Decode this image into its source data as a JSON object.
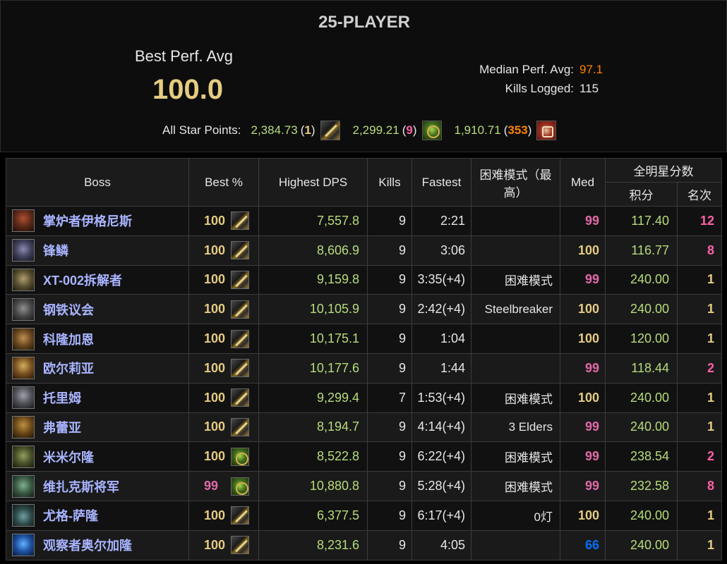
{
  "header": {
    "raid_size": "25-PLAYER",
    "best_perf_label": "Best Perf. Avg",
    "best_perf_value": "100.0",
    "median_label": "Median Perf. Avg:",
    "median_value": "97.1",
    "kills_label": "Kills Logged:",
    "kills_value": "115",
    "star_points_label": "All Star Points:",
    "star_points": [
      {
        "value": "2,384.73",
        "rank": "1",
        "rank_color": "#e5cc80",
        "icon": "rogue-combat-icon"
      },
      {
        "value": "2,299.21",
        "rank": "9",
        "rank_color": "#ff5fa8",
        "icon": "rogue-assassination-icon"
      },
      {
        "value": "1,910.71",
        "rank": "353",
        "rank_color": "#ff8000",
        "icon": "rogue-subtlety-icon"
      }
    ]
  },
  "table": {
    "headers": {
      "boss": "Boss",
      "best": "Best %",
      "dps": "Highest DPS",
      "kills": "Kills",
      "fastest": "Fastest",
      "hard": "困难模式（最高）",
      "med": "Med",
      "allstar": "全明星分数",
      "points": "积分",
      "rank": "名次"
    },
    "rows": [
      {
        "boss": "掌炉者伊格尼斯",
        "best": "100",
        "best_color": "gold",
        "spec_icon": "rogue-combat-icon",
        "dps": "7,557.8",
        "kills": "9",
        "fastest": "2:21",
        "hard": "",
        "med": "99",
        "med_color": "pink",
        "points": "117.40",
        "rank": "12",
        "rank_color": "pink"
      },
      {
        "boss": "锋鳞",
        "best": "100",
        "best_color": "gold",
        "spec_icon": "rogue-combat-icon",
        "dps": "8,606.9",
        "kills": "9",
        "fastest": "3:06",
        "hard": "",
        "med": "100",
        "med_color": "gold",
        "points": "116.77",
        "rank": "8",
        "rank_color": "pink"
      },
      {
        "boss": "XT-002拆解者",
        "best": "100",
        "best_color": "gold",
        "spec_icon": "rogue-combat-icon",
        "dps": "9,159.8",
        "kills": "9",
        "fastest": "3:35(+4)",
        "hard": "困难模式",
        "med": "99",
        "med_color": "pink",
        "points": "240.00",
        "rank": "1",
        "rank_color": "gold"
      },
      {
        "boss": "钢铁议会",
        "best": "100",
        "best_color": "gold",
        "spec_icon": "rogue-combat-icon",
        "dps": "10,105.9",
        "kills": "9",
        "fastest": "2:42(+4)",
        "hard": "Steelbreaker",
        "med": "100",
        "med_color": "gold",
        "points": "240.00",
        "rank": "1",
        "rank_color": "gold"
      },
      {
        "boss": "科隆加恩",
        "best": "100",
        "best_color": "gold",
        "spec_icon": "rogue-combat-icon",
        "dps": "10,175.1",
        "kills": "9",
        "fastest": "1:04",
        "hard": "",
        "med": "100",
        "med_color": "gold",
        "points": "120.00",
        "rank": "1",
        "rank_color": "gold"
      },
      {
        "boss": "欧尔莉亚",
        "best": "100",
        "best_color": "gold",
        "spec_icon": "rogue-combat-icon",
        "dps": "10,177.6",
        "kills": "9",
        "fastest": "1:44",
        "hard": "",
        "med": "99",
        "med_color": "pink",
        "points": "118.44",
        "rank": "2",
        "rank_color": "pink"
      },
      {
        "boss": "托里姆",
        "best": "100",
        "best_color": "gold",
        "spec_icon": "rogue-combat-icon",
        "dps": "9,299.4",
        "kills": "7",
        "fastest": "1:53(+4)",
        "hard": "困难模式",
        "med": "100",
        "med_color": "gold",
        "points": "240.00",
        "rank": "1",
        "rank_color": "gold"
      },
      {
        "boss": "弗蕾亚",
        "best": "100",
        "best_color": "gold",
        "spec_icon": "rogue-combat-icon",
        "dps": "8,194.7",
        "kills": "9",
        "fastest": "4:14(+4)",
        "hard": "3 Elders",
        "med": "99",
        "med_color": "pink",
        "points": "240.00",
        "rank": "1",
        "rank_color": "gold"
      },
      {
        "boss": "米米尔隆",
        "best": "100",
        "best_color": "gold",
        "spec_icon": "rogue-assassination-icon",
        "dps": "8,522.8",
        "kills": "9",
        "fastest": "6:22(+4)",
        "hard": "困难模式",
        "med": "99",
        "med_color": "pink",
        "points": "238.54",
        "rank": "2",
        "rank_color": "pink"
      },
      {
        "boss": "维扎克斯将军",
        "best": "99",
        "best_color": "pink",
        "spec_icon": "rogue-assassination-icon",
        "dps": "10,880.8",
        "kills": "9",
        "fastest": "5:28(+4)",
        "hard": "困难模式",
        "med": "99",
        "med_color": "pink",
        "points": "232.58",
        "rank": "8",
        "rank_color": "pink"
      },
      {
        "boss": "尤格-萨隆",
        "best": "100",
        "best_color": "gold",
        "spec_icon": "rogue-combat-icon",
        "dps": "6,377.5",
        "kills": "9",
        "fastest": "6:17(+4)",
        "hard": "0灯",
        "med": "100",
        "med_color": "gold",
        "points": "240.00",
        "rank": "1",
        "rank_color": "gold"
      },
      {
        "boss": "观察者奥尔加隆",
        "best": "100",
        "best_color": "gold",
        "spec_icon": "rogue-combat-icon",
        "dps": "8,231.6",
        "kills": "9",
        "fastest": "4:05",
        "hard": "",
        "med": "66",
        "med_color": "blue",
        "points": "240.00",
        "rank": "1",
        "rank_color": "gold"
      }
    ]
  },
  "colors": {
    "gold": "#e5cc80",
    "pink": "#e268a8",
    "rank_pink": "#ff5fa8",
    "orange": "#ff8000",
    "blue": "#0070ff",
    "green_value": "#b7dc7a",
    "boss_name": "#a8b4ff"
  }
}
